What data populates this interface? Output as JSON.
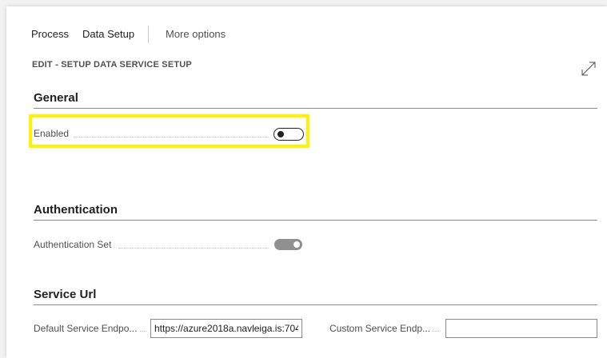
{
  "actions": {
    "process_label": "Process",
    "data_setup_label": "Data Setup",
    "more_options_label": "More options"
  },
  "page": {
    "title": "EDIT - SETUP DATA SERVICE SETUP"
  },
  "sections": {
    "general": {
      "title": "General",
      "enabled_label": "Enabled",
      "enabled_value": false
    },
    "authentication": {
      "title": "Authentication",
      "authentication_set_label": "Authentication Set",
      "authentication_set_value": true
    },
    "service_url": {
      "title": "Service Url",
      "default_label": "Default Service Endpo...",
      "default_value": "https://azure2018a.navleiga.is:704",
      "custom_label": "Custom Service Endp...",
      "custom_value": ""
    }
  },
  "colors": {
    "highlight": "#fff200",
    "toggle_on": "#909090",
    "text": "#212121",
    "label": "#505050"
  },
  "icons": {
    "expand": "expand-diagonal-arrows-icon"
  }
}
